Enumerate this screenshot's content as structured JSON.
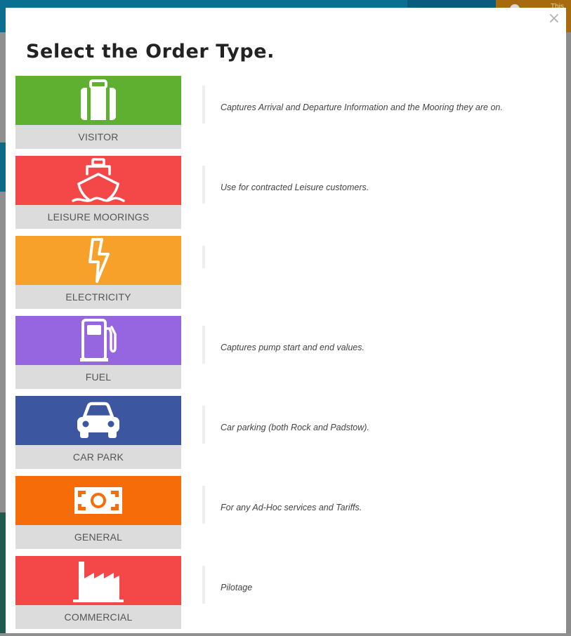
{
  "background": {
    "warning_text": "This",
    "colors": {
      "topbar": "#0b6f92",
      "warning": "#a86a0f",
      "overlay": "#8f8f8f"
    }
  },
  "modal": {
    "title": "Select the Order Type.",
    "close_label": "×"
  },
  "order_types": [
    {
      "label": "VISITOR",
      "description": "Captures Arrival and Departure Information and the Mooring they are on.",
      "color": "#5fb030",
      "icon": "luggage-icon"
    },
    {
      "label": "LEISURE MOORINGS",
      "description": "Use for contracted Leisure customers.",
      "color": "#f44747",
      "icon": "ship-icon"
    },
    {
      "label": "ELECTRICITY",
      "description": "",
      "color": "#f8a12a",
      "icon": "lightning-bolt-icon"
    },
    {
      "label": "FUEL",
      "description": "Captures pump start and end values.",
      "color": "#9566e0",
      "icon": "fuel-pump-icon"
    },
    {
      "label": "CAR PARK",
      "description": "Car parking (both Rock and Padstow).",
      "color": "#3c56a0",
      "icon": "car-icon"
    },
    {
      "label": "GENERAL",
      "description": "For any Ad-Hoc services and Tariffs.",
      "color": "#f56c08",
      "icon": "banknote-icon"
    },
    {
      "label": "COMMERCIAL",
      "description": "Pilotage",
      "color": "#f44747",
      "icon": "factory-icon"
    }
  ]
}
